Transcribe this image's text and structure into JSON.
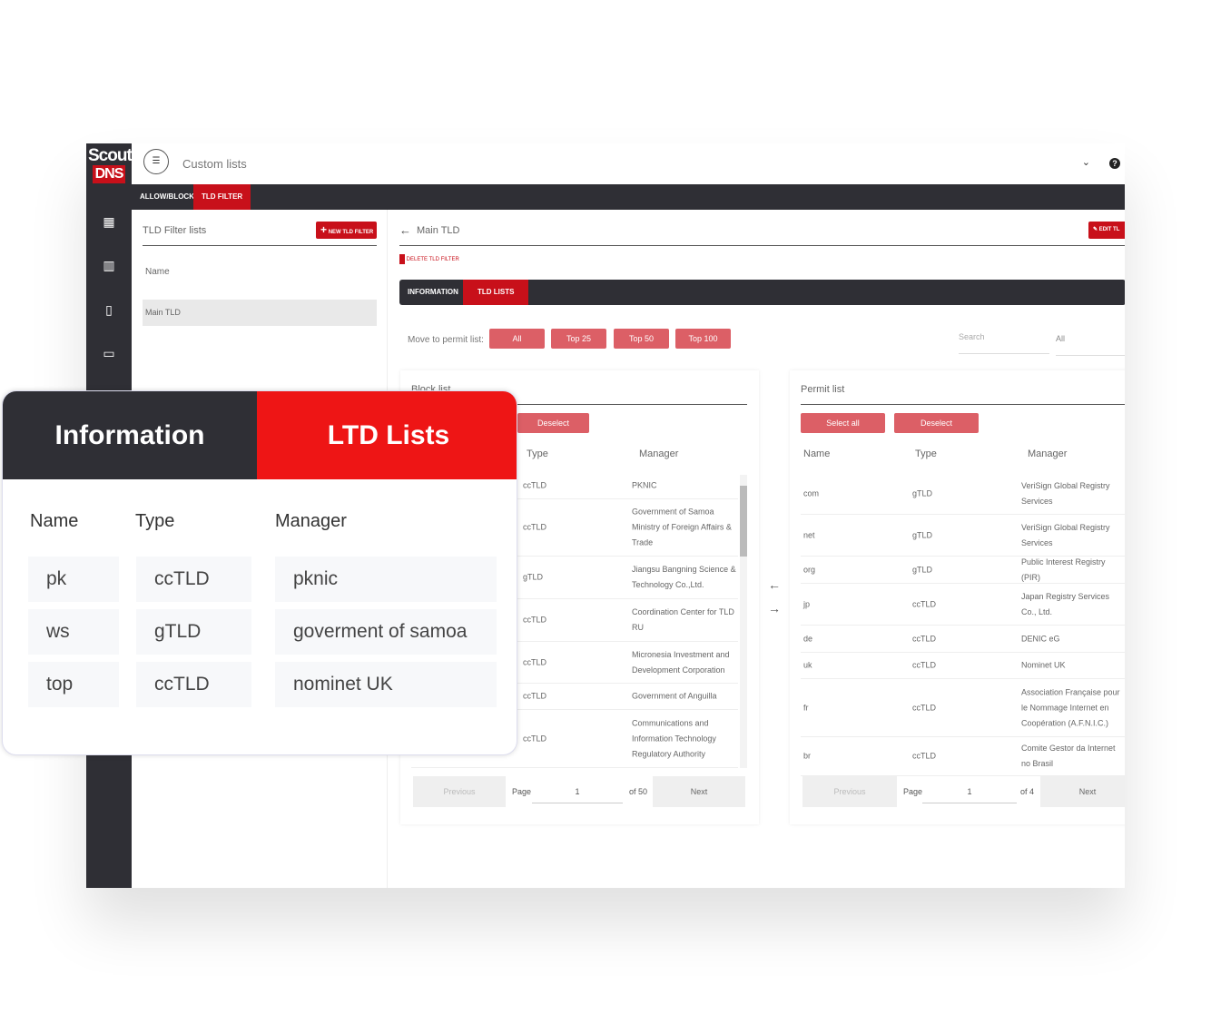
{
  "app": {
    "logo_top": "Scout",
    "logo_bottom": "DNS",
    "title": "Custom lists",
    "help_icon": "question-circle-icon"
  },
  "sidebar": {
    "icons": [
      "dashboard-icon",
      "chart-icon",
      "building-icon",
      "devices-icon"
    ]
  },
  "nav": {
    "tabs": [
      "ALLOW/BLOCK",
      "TLD FILTER"
    ],
    "active": "TLD FILTER"
  },
  "filter_lists": {
    "title": "TLD Filter lists",
    "new_button": "NEW TLD FILTER",
    "column": "Name",
    "items": [
      "Main TLD"
    ]
  },
  "detail": {
    "title": "Main TLD",
    "edit_button": "EDIT TL",
    "delete_button": "DELETE TLD FILTER",
    "tabs": [
      "INFORMATION",
      "TLD LISTS"
    ],
    "active_tab": "TLD LISTS",
    "move_label": "Move to permit list:",
    "move_buttons": [
      "All",
      "Top 25",
      "Top 50",
      "Top 100"
    ],
    "search_placeholder": "Search",
    "filter_value": "All"
  },
  "block_list": {
    "title": "Block list",
    "deselect": "Deselect",
    "columns": [
      "Type",
      "Manager"
    ],
    "rows": [
      [
        "ccTLD",
        "PKNIC"
      ],
      [
        "ccTLD",
        "Government of Samoa Ministry of Foreign Affairs & Trade"
      ],
      [
        "gTLD",
        "Jiangsu Bangning Science & Technology Co.,Ltd."
      ],
      [
        "ccTLD",
        "Coordination Center for TLD RU"
      ],
      [
        "ccTLD",
        "Micronesia Investment and Development Corporation"
      ],
      [
        "ccTLD",
        "Government of Anguilla"
      ],
      [
        "ccTLD",
        "Communications and Information Technology Regulatory Authority"
      ]
    ],
    "pagination": {
      "previous": "Previous",
      "page_label": "Page",
      "page": "1",
      "of": "of 50",
      "next": "Next"
    }
  },
  "permit_list": {
    "title": "Permit list",
    "select_all": "Select all",
    "deselect": "Deselect",
    "columns": [
      "Name",
      "Type",
      "Manager"
    ],
    "rows": [
      [
        "com",
        "gTLD",
        "VeriSign Global Registry Services"
      ],
      [
        "net",
        "gTLD",
        "VeriSign Global Registry Services"
      ],
      [
        "org",
        "gTLD",
        "Public Interest Registry (PIR)"
      ],
      [
        "jp",
        "ccTLD",
        "Japan Registry Services Co., Ltd."
      ],
      [
        "de",
        "ccTLD",
        "DENIC eG"
      ],
      [
        "uk",
        "ccTLD",
        "Nominet UK"
      ],
      [
        "fr",
        "ccTLD",
        "Association Française pour le Nommage Internet en Coopération (A.F.N.I.C.)"
      ],
      [
        "br",
        "ccTLD",
        "Comite Gestor da Internet no Brasil"
      ]
    ],
    "pagination": {
      "previous": "Previous",
      "page_label": "Page",
      "page": "1",
      "of": "of 4",
      "next": "Next"
    }
  },
  "overlay": {
    "tabs": [
      "Information",
      "LTD Lists"
    ],
    "columns": [
      "Name",
      "Type",
      "Manager"
    ],
    "rows": [
      [
        "pk",
        "ccTLD",
        "pknic"
      ],
      [
        "ws",
        "gTLD",
        "goverment of samoa"
      ],
      [
        "top",
        "ccTLD",
        "nominet UK"
      ]
    ]
  },
  "colors": {
    "brand_red": "#c8101a",
    "overlay_red": "#ee1515",
    "dark": "#2f2f35",
    "pink": "#dc5f66"
  }
}
